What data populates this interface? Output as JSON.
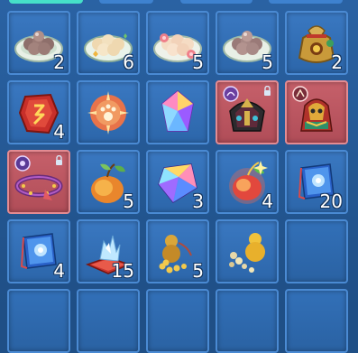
{
  "inventory": {
    "slots": [
      {
        "icon": "taro-ball-plate-icon",
        "count": "2"
      },
      {
        "icon": "glutinous-rice-ball-plate-icon",
        "count": "6"
      },
      {
        "icon": "flower-rice-ball-plate-icon",
        "count": "5"
      },
      {
        "icon": "taro-ball-plate-icon",
        "count": "5"
      },
      {
        "icon": "lucky-pouch-icon",
        "count": "2"
      },
      {
        "icon": "red-rune-stone-icon",
        "count": "4"
      },
      {
        "icon": "glowing-paw-orb-icon",
        "count": ""
      },
      {
        "icon": "rainbow-crystal-icon",
        "count": ""
      },
      {
        "icon": "dragon-armor-icon",
        "count": "",
        "locked": true
      },
      {
        "icon": "golden-guardian-icon",
        "count": "",
        "locked": true
      },
      {
        "icon": "purple-collar-icon",
        "count": "",
        "locked": true
      },
      {
        "icon": "peach-fruit-icon",
        "count": "5"
      },
      {
        "icon": "rainbow-gem-icon",
        "count": "3"
      },
      {
        "icon": "magic-peach-icon",
        "count": "4"
      },
      {
        "icon": "blue-skill-book-icon",
        "count": "20"
      },
      {
        "icon": "blue-skill-book-icon",
        "count": "4"
      },
      {
        "icon": "crystal-cushion-icon",
        "count": "15"
      },
      {
        "icon": "gourd-beads-icon",
        "count": "5"
      },
      {
        "icon": "golden-gourd-icon",
        "count": ""
      },
      {
        "icon": "empty",
        "count": ""
      },
      {
        "icon": "empty",
        "count": ""
      },
      {
        "icon": "empty",
        "count": ""
      },
      {
        "icon": "empty",
        "count": ""
      },
      {
        "icon": "empty",
        "count": ""
      },
      {
        "icon": "empty",
        "count": ""
      }
    ]
  },
  "colors": {
    "panel": "#1f4f86",
    "slot": "#3a78c1",
    "slot_locked": "#c6606a",
    "count_text": "#ffffff"
  }
}
